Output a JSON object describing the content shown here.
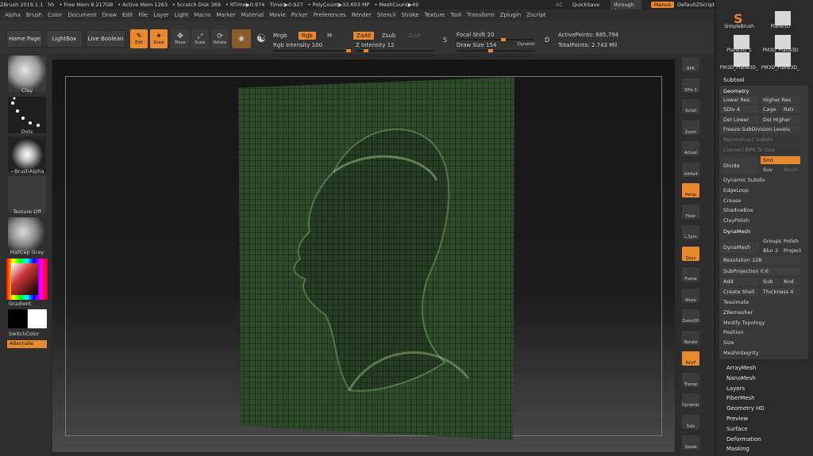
{
  "status": {
    "app": "ZBrush 2019.1.1",
    "doc": "hh",
    "free_mem": "• Free Mem 8.217GB",
    "active_mem": "• Active Mem 1263",
    "scratch": "• Scratch Disk 369",
    "rtime": "• RTime▶0.974",
    "timer": "Timer▶0.927",
    "polycount": "• PolyCount▶33.603 MP",
    "meshcount": "• MeshCount▶49"
  },
  "topright": {
    "ac": "AC",
    "quicksave": "QuickSave",
    "seethrough": "See-through  0",
    "menus": "Menus",
    "script": "DefaultZScript"
  },
  "menus": [
    "Alpha",
    "Brush",
    "Color",
    "Document",
    "Draw",
    "Edit",
    "File",
    "Layer",
    "Light",
    "Macro",
    "Marker",
    "Material",
    "Movie",
    "Picker",
    "Preferences",
    "Render",
    "Stencil",
    "Stroke",
    "Texture",
    "Tool",
    "Transform",
    "Zplugin",
    "Zscript"
  ],
  "shelf": {
    "home": "Home Page",
    "lightbox": "LightBox",
    "liveboolean": "Live Boolean",
    "edit": "Edit",
    "draw": "Draw",
    "move": "Move",
    "scale": "Scale",
    "rotate": "Rotate",
    "mrgb": "Mrgb",
    "rgb": "Rgb",
    "m": "M",
    "rgb_intensity": "Rgb Intensity 100",
    "zadd": "Zadd",
    "zsub": "Zsub",
    "zcut": "Zcut",
    "z_intensity": "Z Intensity 12",
    "focal": "Focal Shift 20",
    "drawsize": "Draw Size 154",
    "dynamic": "Dynamic",
    "activepoints": "ActivePoints: 685,794",
    "totalpoints": "TotalPoints: 2.743 Mil"
  },
  "left": {
    "clay": "Clay",
    "dots": "Dots",
    "alpha": "~BrushAlpha",
    "texture": "Texture Off",
    "matcap": "MatCap Gray",
    "gradient": "Gradient",
    "switch": "SwitchColor",
    "alternate": "Alternate"
  },
  "strip": [
    "BPR",
    "SPix 3",
    "Scroll",
    "Zoom",
    "Actual",
    "AAHalf",
    "Persp",
    "Floor",
    "L.Sym",
    "Qxyz",
    "Frame",
    "Move",
    "Zoom3D",
    "Rotate",
    "PolyF",
    "Transp",
    "Dynamic",
    "Solo",
    "Xpose"
  ],
  "tool_thumbs": [
    "SimpleBrush",
    "Plane3D",
    "Plane3D_1",
    "PM3D_Plane3D",
    "PM3D_Plane3D_",
    "PM3D_Plane3D_"
  ],
  "subtool": "Subtool",
  "geometry": {
    "title": "Geometry",
    "lower_res": "Lower Res",
    "higher_res": "Higher Res",
    "sdiv": "SDiv 4",
    "cage": "Cage",
    "rstr": "Rstr",
    "del_lower": "Del Lower",
    "del_higher": "Del Higher",
    "freeze": "Freeze SubDivision Levels",
    "reconstruct": "Reconstruct Subdiv",
    "convert": "Convert BPR To Geo",
    "divide": "Divide",
    "smt": "Smt",
    "suv": "Suv",
    "reuv": "ReUV",
    "items": [
      "Dynamic Subdiv",
      "EdgeLoop",
      "Crease",
      "ShadowBox",
      "ClayPolish"
    ]
  },
  "dynamesh": {
    "title": "DynaMesh",
    "dynamesh": "DynaMesh",
    "groups": "Groups",
    "polish": "Polish",
    "blur": "Blur 2",
    "project": "Project",
    "resolution": "Resolution 128",
    "subprojection": "SubProjection 0.6",
    "add": "Add",
    "sub": "Sub",
    "and": "And",
    "create_shell": "Create Shell",
    "thickness": "Thickness 4"
  },
  "geo_more": [
    "Tessimate",
    "ZRemesher",
    "Modify Topology",
    "Position",
    "Size",
    "MeshIntegrity"
  ],
  "bottom_menus": [
    "ArrayMesh",
    "NanoMesh",
    "Layers",
    "FiberMesh",
    "Geometry HD",
    "Preview",
    "Surface",
    "Deformation",
    "Masking"
  ]
}
